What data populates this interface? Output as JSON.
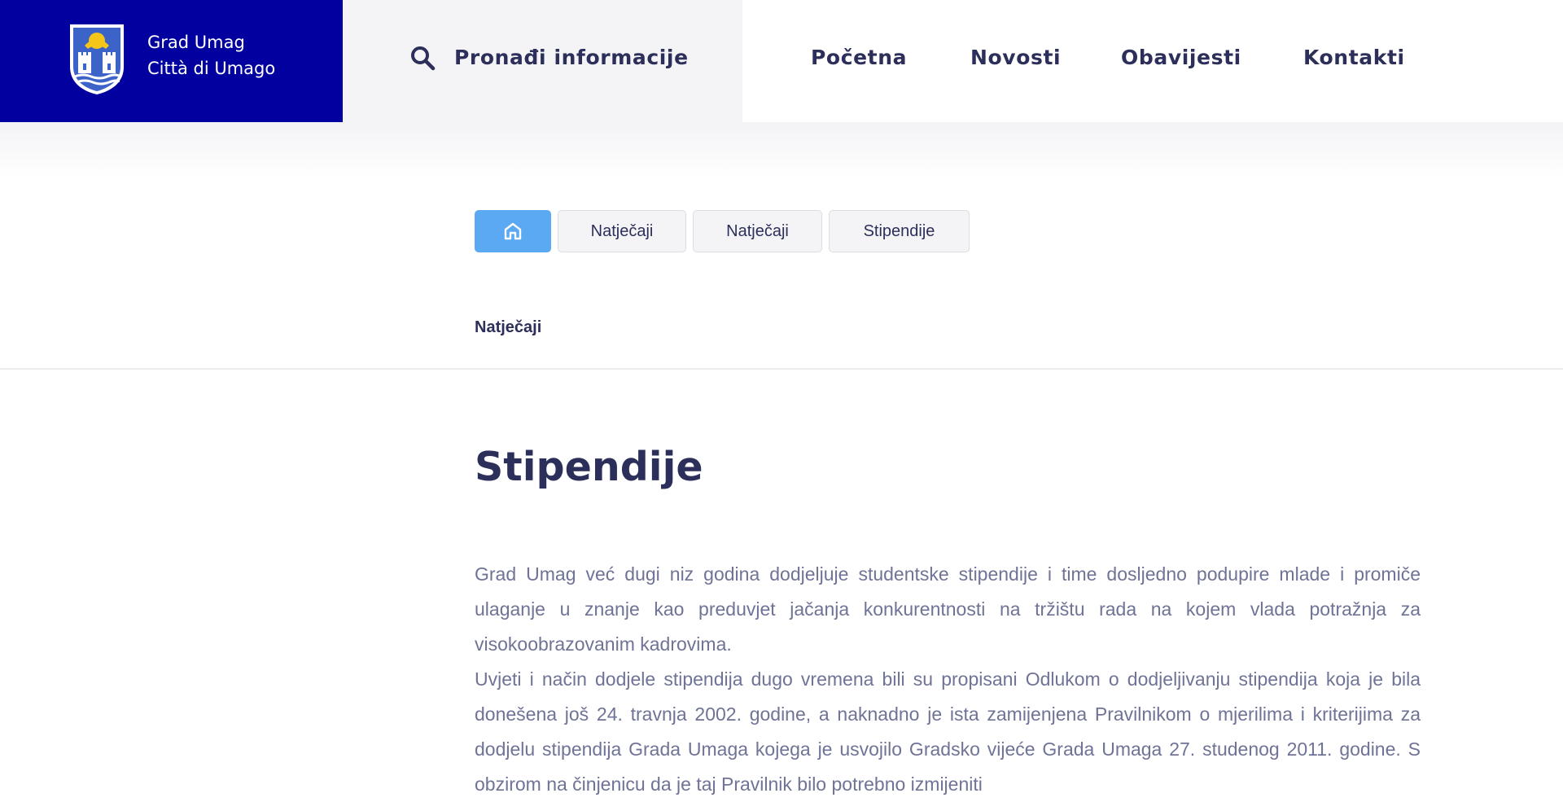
{
  "header": {
    "logo": {
      "line1": "Grad Umag",
      "line2": "Città di Umago",
      "background": "#0201a0",
      "icon": "city-crest-icon"
    },
    "search": {
      "label": "Pronađi informacije",
      "icon": "search-icon"
    },
    "nav": [
      {
        "label": "Početna"
      },
      {
        "label": "Novosti"
      },
      {
        "label": "Obavijesti"
      },
      {
        "label": "Kontakti"
      }
    ]
  },
  "breadcrumb": {
    "home_icon": "home-icon",
    "home_color": "#5aa9f2",
    "items": [
      {
        "label": "Natječaji"
      },
      {
        "label": "Natječaji"
      },
      {
        "label": "Stipendije"
      }
    ]
  },
  "section_label": "Natječaji",
  "page": {
    "title": "Stipendije",
    "paragraphs": [
      "Grad Umag već dugi niz godina dodjeljuje studentske stipendije i time dosljedno podupire mlade i promiče ulaganje u znanje kao preduvjet jačanja konkurentnosti na tržištu rada na kojem vlada potražnja za visokoobrazovanim kadrovima.",
      "Uvjeti i način dodjele stipendija dugo vremena bili su propisani Odlukom o dodjeljivanju stipendija koja je bila donešena još 24. travnja 2002. godine, a naknadno je ista zamijenjena Pravilnikom o mjerilima i kriterijima za dodjelu stipendija Grada Umaga kojega je usvojilo Gradsko vijeće Grada Umaga 27. studenog 2011. godine. S obzirom na činjenicu da je taj Pravilnik bilo potrebno izmijeniti"
    ]
  }
}
